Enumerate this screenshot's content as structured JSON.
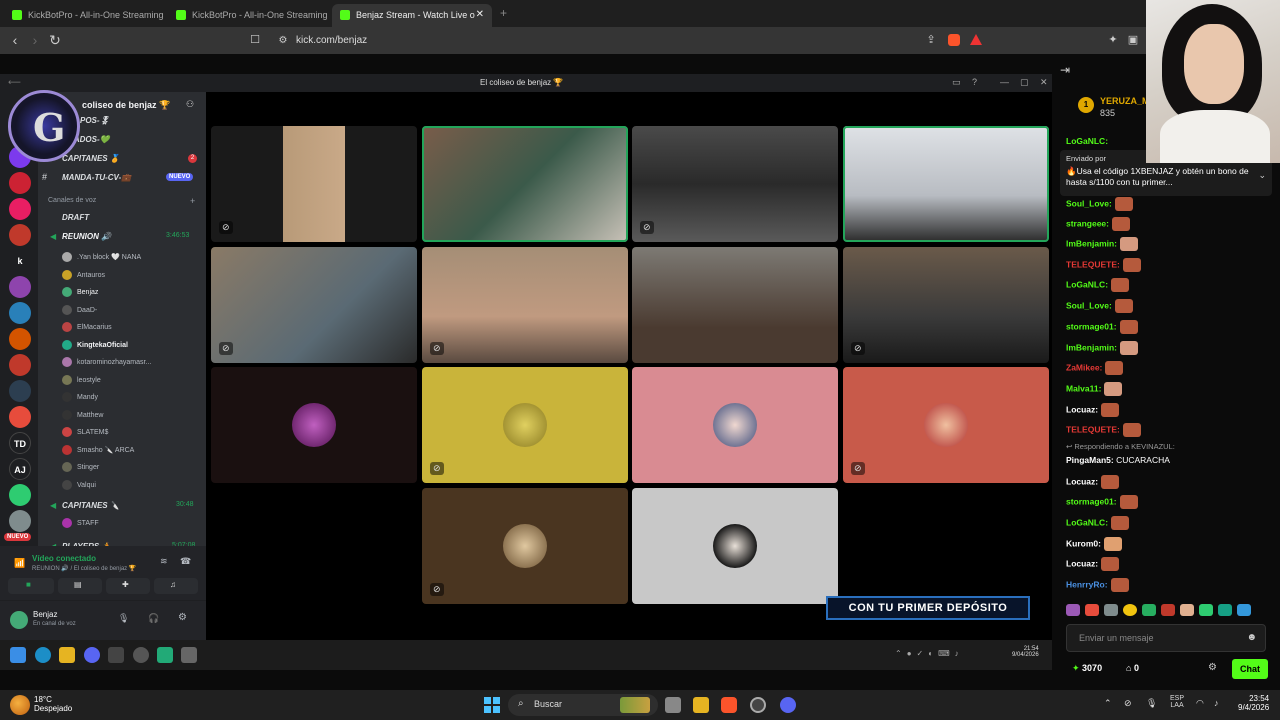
{
  "browser": {
    "tabs": [
      {
        "title": "KickBotPro - All-in-One Streaming To"
      },
      {
        "title": "KickBotPro - All-in-One Streaming To"
      },
      {
        "title": "Benjaz Stream - Watch Live o"
      }
    ],
    "new_tab": "+",
    "url": "kick.com/benjaz"
  },
  "discord": {
    "window_title": "El coliseo de benjaz 🏆",
    "server_name": "coliseo de benjaz 🏆",
    "guild_labels": [
      "k",
      "TD",
      "AJ"
    ],
    "nuevo_label": "NUEVO",
    "channels": [
      {
        "name": "POS-🎖",
        "style": "bold"
      },
      {
        "name": "VITADOS-💚",
        "style": "bold"
      },
      {
        "name": "CAPITANES 🏅",
        "style": "bold",
        "badge": "2"
      },
      {
        "name": "MANDA-TU-CV-💼",
        "style": "bold",
        "badge": "NUEVO"
      }
    ],
    "voice_header": "Canales de voz",
    "voice_channels": [
      {
        "name": "DRAFT"
      },
      {
        "name": "REUNION 🔊",
        "time": "3:46:53"
      }
    ],
    "voice_users": [
      {
        "name": ".Yan block 🤍 NANA"
      },
      {
        "name": "Antauros"
      },
      {
        "name": "Benjaz"
      },
      {
        "name": "DaaD-"
      },
      {
        "name": "ElMacarius"
      },
      {
        "name": "KingtekaOficial"
      },
      {
        "name": "kotarominozhayamasr..."
      },
      {
        "name": "leostyle"
      },
      {
        "name": "Mandy"
      },
      {
        "name": "Matthew"
      },
      {
        "name": "SLATEM$"
      },
      {
        "name": "Smasho 🔪 ARCA"
      },
      {
        "name": "Stinger"
      },
      {
        "name": "Valqui"
      }
    ],
    "capitanes_channel": {
      "name": "CAPITANES 🔪",
      "time": "30:48"
    },
    "staff_user": "STAFF",
    "players_channel": {
      "name": "PLAYERS 🏃",
      "time": "5:07:08"
    },
    "voice_status": "Vídeo conectado",
    "voice_location": "REUNION 🔊 / El coliseo de benjaz 🏆",
    "user_name": "Benjaz",
    "user_status": "En canal de voz",
    "promo_text": "CON TU PRIMER DEPÓSITO",
    "taskbar_time": "21:54",
    "taskbar_date": "9/04/2026"
  },
  "chat": {
    "top_user": "YERUZA_M",
    "top_user_rank": "1",
    "top_user_points": "835",
    "partial_line": "LoGaNLC:",
    "pinned_by": "Enviado por",
    "pinned_text": "🔥Usa el código 1XBENJAZ y obtén un bono de hasta s/1100 con tu primer...",
    "messages": [
      {
        "user": "Soul_Love:",
        "color": "#53fc18"
      },
      {
        "user": "strangeee:",
        "color": "#53fc18"
      },
      {
        "user": "lmBenjamin:",
        "color": "#53fc18"
      },
      {
        "user": "TELEQUETE:",
        "color": "#e53935"
      },
      {
        "user": "LoGaNLC:",
        "color": "#53fc18"
      },
      {
        "user": "Soul_Love:",
        "color": "#53fc18"
      },
      {
        "user": "stormage01:",
        "color": "#53fc18"
      },
      {
        "user": "lmBenjamin:",
        "color": "#53fc18"
      },
      {
        "user": "ZaMikee:",
        "color": "#e53935"
      },
      {
        "user": "Malva11:",
        "color": "#53fc18"
      },
      {
        "user": "Locuaz:",
        "color": "#ffffff"
      },
      {
        "user": "TELEQUETE:",
        "color": "#e53935"
      }
    ],
    "reply_to": "Respondiendo a KEVINAZUL:",
    "reply_msg": {
      "user": "PingaMan5:",
      "text": "CUCARACHA"
    },
    "messages2": [
      {
        "user": "Locuaz:",
        "color": "#ffffff"
      },
      {
        "user": "stormage01:",
        "color": "#53fc18"
      },
      {
        "user": "LoGaNLC:",
        "color": "#53fc18"
      },
      {
        "user": "Kurom0:",
        "color": "#ffffff"
      },
      {
        "user": "Locuaz:",
        "color": "#ffffff"
      },
      {
        "user": "HenrryRo:",
        "color": "#4a90e2"
      }
    ],
    "input_placeholder": "Enviar un mensaje",
    "points": "3070",
    "gift_count": "0",
    "chat_button": "Chat"
  },
  "taskbar": {
    "weather_temp": "18°C",
    "weather_desc": "Despejado",
    "search_label": "Buscar",
    "lang": "ESP",
    "lang2": "LAA",
    "time": "23:54",
    "date": "9/4/2026"
  },
  "colors": {
    "kick_green": "#53fc18",
    "discord_bg": "#2b2d31",
    "discord_green": "#23a55a"
  }
}
